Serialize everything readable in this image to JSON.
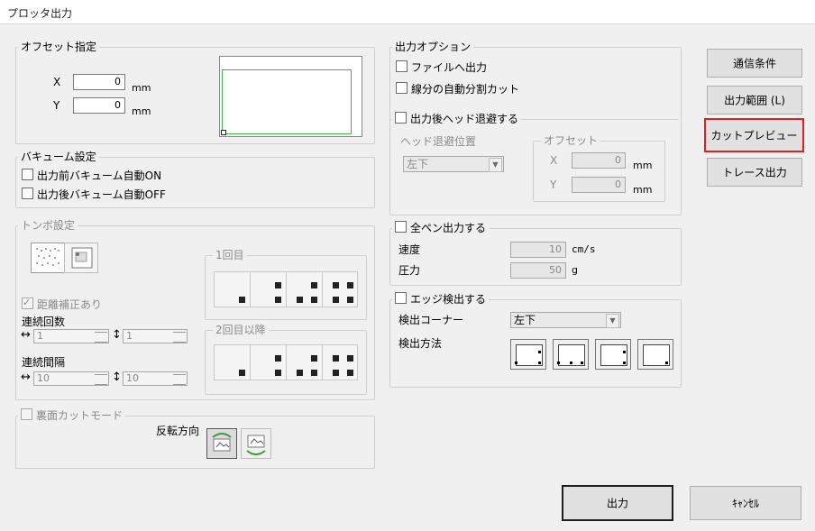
{
  "window": {
    "title": "プロッタ出力"
  },
  "offset": {
    "title": "オフセット指定",
    "x_label": "X",
    "x_value": "0",
    "x_unit": "mm",
    "y_label": "Y",
    "y_value": "0",
    "y_unit": "mm"
  },
  "vacuum": {
    "title": "バキューム設定",
    "before_on": "出力前バキューム自動ON",
    "after_off": "出力後バキューム自動OFF"
  },
  "tombo": {
    "title": "トンボ設定",
    "first_group": "1回目",
    "second_group": "2回目以降",
    "distance_correction": "距離補正あり",
    "repeat_count_label": "連続回数",
    "repeat_x": "1",
    "repeat_y": "1",
    "interval_label": "連続間隔",
    "interval_x": "10",
    "interval_y": "10"
  },
  "backside": {
    "title": "裏面カットモード",
    "direction_label": "反転方向"
  },
  "output_options": {
    "title": "出力オプション",
    "to_file": "ファイルへ出力",
    "auto_split": "線分の自動分割カット"
  },
  "head_retract": {
    "title": "出力後ヘッド退避する",
    "position_label": "ヘッド退避位置",
    "position_value": "左下",
    "offset_title": "オフセット",
    "x_label": "X",
    "x_value": "0",
    "x_unit": "mm",
    "y_label": "Y",
    "y_value": "0",
    "y_unit": "mm"
  },
  "all_pen": {
    "title": "全ペン出力する",
    "speed_label": "速度",
    "speed_value": "10",
    "speed_unit": "cm/s",
    "pressure_label": "圧力",
    "pressure_value": "50",
    "pressure_unit": "g"
  },
  "edge_detect": {
    "title": "エッジ検出する",
    "corner_label": "検出コーナー",
    "corner_value": "左下",
    "method_label": "検出方法"
  },
  "side_buttons": {
    "comm": "通信条件",
    "range": "出力範囲 (L)",
    "cut_preview": "カットプレビュー",
    "trace": "トレース出力"
  },
  "bottom_buttons": {
    "output": "出力",
    "cancel": "ｷｬﾝｾﾙ"
  },
  "colors": {
    "highlight": "#e02020",
    "preview_rect": "#3cb83c"
  }
}
